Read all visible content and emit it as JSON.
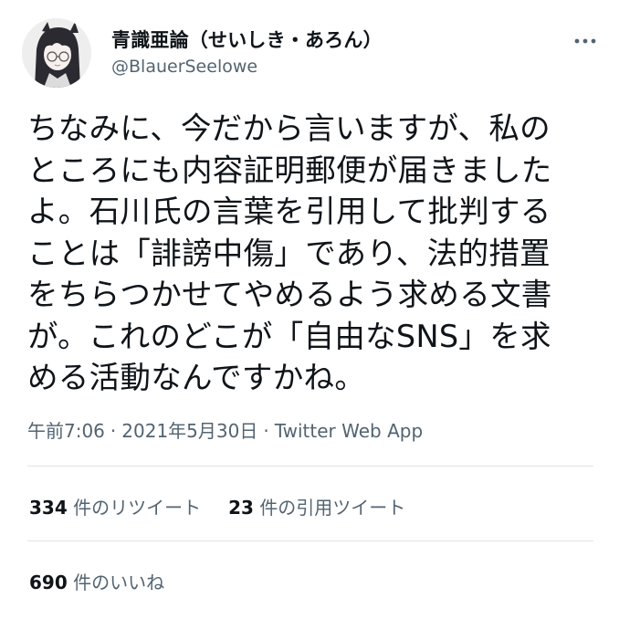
{
  "tweet": {
    "display_name": "青識亜論（せいしき・あろん）",
    "handle": "@BlauerSeelowe",
    "text_lines": [
      "ちなみに、今だから言いますが、私の",
      "ところにも内容証明郵便が届きました",
      "よ。石川氏の言葉を引用して批判する",
      "ことは「誹謗中傷」であり、法的措置",
      "をちらつかせてやめるよう求める文書",
      "が。これのどこが「自由なSNS」を求",
      "める活動なんですかね。"
    ],
    "time": "午前7:06",
    "date": "2021年5月30日",
    "separator": "·",
    "source": "Twitter Web App"
  },
  "stats": {
    "retweets_count": "334",
    "retweets_label": "件のリツイート",
    "quotes_count": "23",
    "quotes_label": "件の引用ツイート",
    "likes_count": "690",
    "likes_label": "件のいいね"
  },
  "icons": {
    "more": "more-horizontal-icon",
    "avatar": "avatar-image"
  },
  "colors": {
    "text": "#0f1419",
    "secondary": "#536471",
    "divider": "#dfe3e6"
  }
}
